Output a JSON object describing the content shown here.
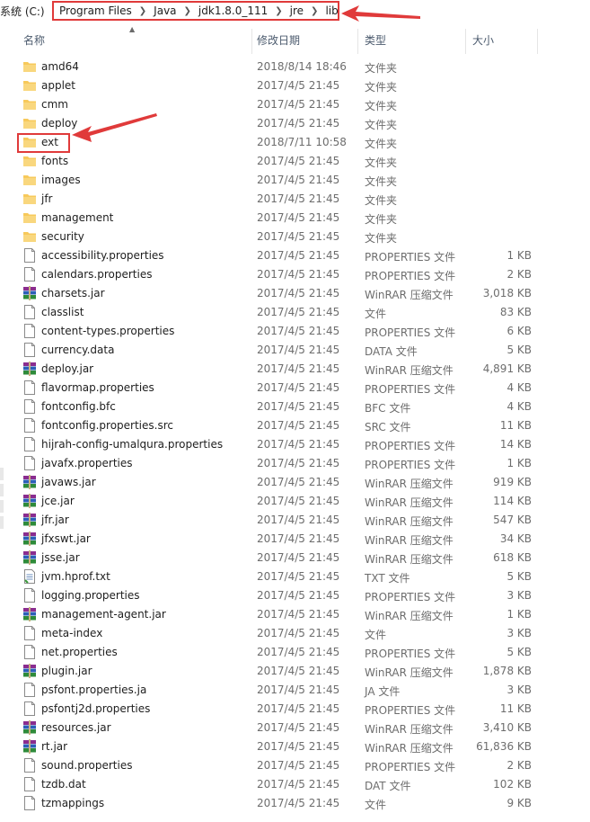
{
  "breadcrumb": {
    "prefix": "系统 (C:)",
    "items": [
      "Program Files",
      "Java",
      "jdk1.8.0_111",
      "jre",
      "lib"
    ]
  },
  "header": {
    "name": "名称",
    "date": "修改日期",
    "type": "类型",
    "size": "大小"
  },
  "colors": {
    "highlight": "#e03a3a",
    "folder": "#f7c95b",
    "jar": "#3a6ac8"
  },
  "rows": [
    {
      "name": "amd64",
      "date": "2018/8/14 18:46",
      "type": "文件夹",
      "size": "",
      "icon": "folder-icon"
    },
    {
      "name": "applet",
      "date": "2017/4/5 21:45",
      "type": "文件夹",
      "size": "",
      "icon": "folder-icon"
    },
    {
      "name": "cmm",
      "date": "2017/4/5 21:45",
      "type": "文件夹",
      "size": "",
      "icon": "folder-icon"
    },
    {
      "name": "deploy",
      "date": "2017/4/5 21:45",
      "type": "文件夹",
      "size": "",
      "icon": "folder-icon"
    },
    {
      "name": "ext",
      "date": "2018/7/11 10:58",
      "type": "文件夹",
      "size": "",
      "icon": "folder-icon"
    },
    {
      "name": "fonts",
      "date": "2017/4/5 21:45",
      "type": "文件夹",
      "size": "",
      "icon": "folder-icon"
    },
    {
      "name": "images",
      "date": "2017/4/5 21:45",
      "type": "文件夹",
      "size": "",
      "icon": "folder-icon"
    },
    {
      "name": "jfr",
      "date": "2017/4/5 21:45",
      "type": "文件夹",
      "size": "",
      "icon": "folder-icon"
    },
    {
      "name": "management",
      "date": "2017/4/5 21:45",
      "type": "文件夹",
      "size": "",
      "icon": "folder-icon"
    },
    {
      "name": "security",
      "date": "2017/4/5 21:45",
      "type": "文件夹",
      "size": "",
      "icon": "folder-icon"
    },
    {
      "name": "accessibility.properties",
      "date": "2017/4/5 21:45",
      "type": "PROPERTIES 文件",
      "size": "1 KB",
      "icon": "file-icon"
    },
    {
      "name": "calendars.properties",
      "date": "2017/4/5 21:45",
      "type": "PROPERTIES 文件",
      "size": "2 KB",
      "icon": "file-icon"
    },
    {
      "name": "charsets.jar",
      "date": "2017/4/5 21:45",
      "type": "WinRAR 压缩文件",
      "size": "3,018 KB",
      "icon": "archive-icon"
    },
    {
      "name": "classlist",
      "date": "2017/4/5 21:45",
      "type": "文件",
      "size": "83 KB",
      "icon": "file-icon"
    },
    {
      "name": "content-types.properties",
      "date": "2017/4/5 21:45",
      "type": "PROPERTIES 文件",
      "size": "6 KB",
      "icon": "file-icon"
    },
    {
      "name": "currency.data",
      "date": "2017/4/5 21:45",
      "type": "DATA 文件",
      "size": "5 KB",
      "icon": "file-icon"
    },
    {
      "name": "deploy.jar",
      "date": "2017/4/5 21:45",
      "type": "WinRAR 压缩文件",
      "size": "4,891 KB",
      "icon": "archive-icon"
    },
    {
      "name": "flavormap.properties",
      "date": "2017/4/5 21:45",
      "type": "PROPERTIES 文件",
      "size": "4 KB",
      "icon": "file-icon"
    },
    {
      "name": "fontconfig.bfc",
      "date": "2017/4/5 21:45",
      "type": "BFC 文件",
      "size": "4 KB",
      "icon": "file-icon"
    },
    {
      "name": "fontconfig.properties.src",
      "date": "2017/4/5 21:45",
      "type": "SRC 文件",
      "size": "11 KB",
      "icon": "file-icon"
    },
    {
      "name": "hijrah-config-umalqura.properties",
      "date": "2017/4/5 21:45",
      "type": "PROPERTIES 文件",
      "size": "14 KB",
      "icon": "file-icon"
    },
    {
      "name": "javafx.properties",
      "date": "2017/4/5 21:45",
      "type": "PROPERTIES 文件",
      "size": "1 KB",
      "icon": "file-icon"
    },
    {
      "name": "javaws.jar",
      "date": "2017/4/5 21:45",
      "type": "WinRAR 压缩文件",
      "size": "919 KB",
      "icon": "archive-icon"
    },
    {
      "name": "jce.jar",
      "date": "2017/4/5 21:45",
      "type": "WinRAR 压缩文件",
      "size": "114 KB",
      "icon": "archive-icon"
    },
    {
      "name": "jfr.jar",
      "date": "2017/4/5 21:45",
      "type": "WinRAR 压缩文件",
      "size": "547 KB",
      "icon": "archive-icon"
    },
    {
      "name": "jfxswt.jar",
      "date": "2017/4/5 21:45",
      "type": "WinRAR 压缩文件",
      "size": "34 KB",
      "icon": "archive-icon"
    },
    {
      "name": "jsse.jar",
      "date": "2017/4/5 21:45",
      "type": "WinRAR 压缩文件",
      "size": "618 KB",
      "icon": "archive-icon"
    },
    {
      "name": "jvm.hprof.txt",
      "date": "2017/4/5 21:45",
      "type": "TXT 文件",
      "size": "5 KB",
      "icon": "text-file-icon"
    },
    {
      "name": "logging.properties",
      "date": "2017/4/5 21:45",
      "type": "PROPERTIES 文件",
      "size": "3 KB",
      "icon": "file-icon"
    },
    {
      "name": "management-agent.jar",
      "date": "2017/4/5 21:45",
      "type": "WinRAR 压缩文件",
      "size": "1 KB",
      "icon": "archive-icon"
    },
    {
      "name": "meta-index",
      "date": "2017/4/5 21:45",
      "type": "文件",
      "size": "3 KB",
      "icon": "file-icon"
    },
    {
      "name": "net.properties",
      "date": "2017/4/5 21:45",
      "type": "PROPERTIES 文件",
      "size": "5 KB",
      "icon": "file-icon"
    },
    {
      "name": "plugin.jar",
      "date": "2017/4/5 21:45",
      "type": "WinRAR 压缩文件",
      "size": "1,878 KB",
      "icon": "archive-icon"
    },
    {
      "name": "psfont.properties.ja",
      "date": "2017/4/5 21:45",
      "type": "JA 文件",
      "size": "3 KB",
      "icon": "file-icon"
    },
    {
      "name": "psfontj2d.properties",
      "date": "2017/4/5 21:45",
      "type": "PROPERTIES 文件",
      "size": "11 KB",
      "icon": "file-icon"
    },
    {
      "name": "resources.jar",
      "date": "2017/4/5 21:45",
      "type": "WinRAR 压缩文件",
      "size": "3,410 KB",
      "icon": "archive-icon"
    },
    {
      "name": "rt.jar",
      "date": "2017/4/5 21:45",
      "type": "WinRAR 压缩文件",
      "size": "61,836 KB",
      "icon": "archive-icon"
    },
    {
      "name": "sound.properties",
      "date": "2017/4/5 21:45",
      "type": "PROPERTIES 文件",
      "size": "2 KB",
      "icon": "file-icon"
    },
    {
      "name": "tzdb.dat",
      "date": "2017/4/5 21:45",
      "type": "DAT 文件",
      "size": "102 KB",
      "icon": "file-icon"
    },
    {
      "name": "tzmappings",
      "date": "2017/4/5 21:45",
      "type": "文件",
      "size": "9 KB",
      "icon": "file-icon"
    }
  ]
}
